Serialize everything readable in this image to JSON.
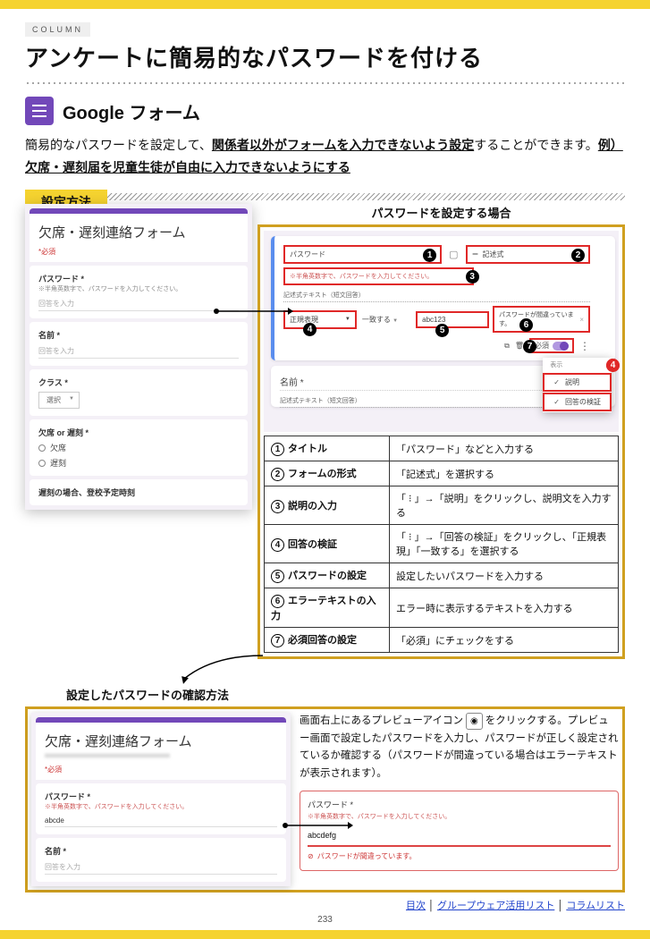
{
  "header": {
    "column_label": "COLUMN",
    "title": "アンケートに簡易的なパスワードを付ける"
  },
  "app": {
    "name": "Google フォーム"
  },
  "intro": {
    "a": "簡易的なパスワードを設定して、",
    "b": "関係者以外がフォームを入力できないよう設定",
    "c": "することができます。",
    "d": "例）欠席・遅刻届を児童生徒が自由に入力できないようにする"
  },
  "section1": {
    "label": "設定方法",
    "caption": "パスワードを設定する場合"
  },
  "form_left": {
    "title": "欠席・遅刻連絡フォーム",
    "required_note": "*必須",
    "q_password": "パスワード *",
    "q_password_sub": "※半角英数字で、パスワードを入力してください。",
    "ans_placeholder": "回答を入力",
    "q_name": "名前 *",
    "q_class": "クラス *",
    "class_value": "選択",
    "q_absent": "欠席 or 遅刻 *",
    "r1": "欠席",
    "r2": "遅刻",
    "q_reason": "遅刻の場合、登校予定時刻"
  },
  "editor": {
    "title_input": "パスワード",
    "format": "記述式",
    "desc_input": "※半角英数字で、パスワードを入力してください。",
    "short_text": "記述式テキスト（短文回答）",
    "regex": "正規表現",
    "match": "一致する",
    "pw": "abc123",
    "err": "パスワードが間違っています。",
    "required_label": "必須",
    "name_label": "名前 *",
    "popup_header": "表示",
    "popup_desc": "説明",
    "popup_valid": "回答の検証"
  },
  "table": [
    {
      "n": "❶",
      "l": "タイトル",
      "r": "「パスワード」などと入力する"
    },
    {
      "n": "❷",
      "l": "フォームの形式",
      "r": "「記述式」を選択する"
    },
    {
      "n": "❸",
      "l": "説明の入力",
      "r": "「 ⁝ 」→「説明」をクリックし、説明文を入力する"
    },
    {
      "n": "❹",
      "l": "回答の検証",
      "r": "「 ⁝ 」→「回答の検証」をクリックし、「正規表現」「一致する」を選択する"
    },
    {
      "n": "❺",
      "l": "パスワードの設定",
      "r": "設定したいパスワードを入力する"
    },
    {
      "n": "❻",
      "l": "エラーテキストの入力",
      "r": "エラー時に表示するテキストを入力する"
    },
    {
      "n": "❼",
      "l": "必須回答の設定",
      "r": "「必須」にチェックをする"
    }
  ],
  "section2": {
    "title": "設定したパスワードの確認方法",
    "p1": "画面右上にあるプレビューアイコン",
    "p2": "をクリックする。プレビュー画面で設定したパスワードを入力し、パスワードが正しく設定されているか確認する（パスワードが間違っている場合はエラーテキストが表示されます）。"
  },
  "err_box": {
    "label": "パスワード *",
    "sub": "※半角英数字で、パスワードを入力してください。",
    "input": "abcdefg",
    "msg": "パスワードが間違っています。"
  },
  "form2": {
    "title": "欠席・遅刻連絡フォーム",
    "pw_label": "パスワード *",
    "pw_sub": "※半角英数字で、パスワードを入力してください。",
    "pw_val": "abcde",
    "name_label": "名前 *",
    "ans": "回答を入力"
  },
  "footer": {
    "toc": "目次",
    "list": "グループウェア活用リスト",
    "col": "コラムリスト",
    "page": "233"
  }
}
